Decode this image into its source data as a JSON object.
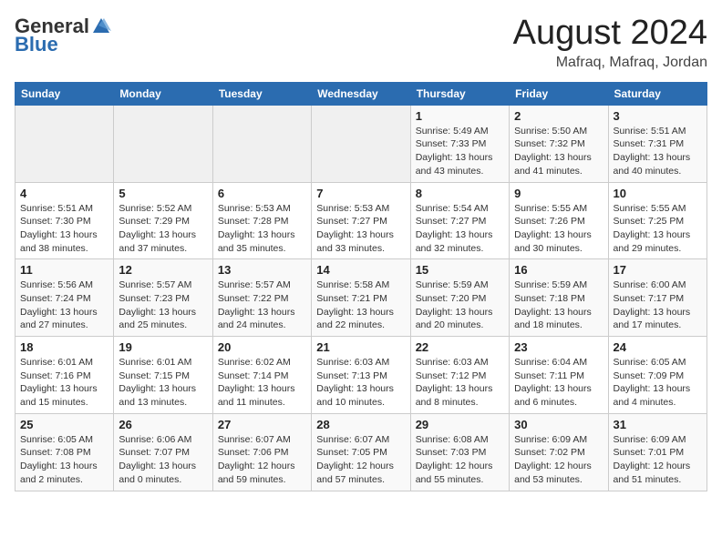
{
  "header": {
    "logo_general": "General",
    "logo_blue": "Blue",
    "main_title": "August 2024",
    "subtitle": "Mafraq, Mafraq, Jordan"
  },
  "days_of_week": [
    "Sunday",
    "Monday",
    "Tuesday",
    "Wednesday",
    "Thursday",
    "Friday",
    "Saturday"
  ],
  "weeks": [
    [
      {
        "day": "",
        "info": ""
      },
      {
        "day": "",
        "info": ""
      },
      {
        "day": "",
        "info": ""
      },
      {
        "day": "",
        "info": ""
      },
      {
        "day": "1",
        "info": "Sunrise: 5:49 AM\nSunset: 7:33 PM\nDaylight: 13 hours\nand 43 minutes."
      },
      {
        "day": "2",
        "info": "Sunrise: 5:50 AM\nSunset: 7:32 PM\nDaylight: 13 hours\nand 41 minutes."
      },
      {
        "day": "3",
        "info": "Sunrise: 5:51 AM\nSunset: 7:31 PM\nDaylight: 13 hours\nand 40 minutes."
      }
    ],
    [
      {
        "day": "4",
        "info": "Sunrise: 5:51 AM\nSunset: 7:30 PM\nDaylight: 13 hours\nand 38 minutes."
      },
      {
        "day": "5",
        "info": "Sunrise: 5:52 AM\nSunset: 7:29 PM\nDaylight: 13 hours\nand 37 minutes."
      },
      {
        "day": "6",
        "info": "Sunrise: 5:53 AM\nSunset: 7:28 PM\nDaylight: 13 hours\nand 35 minutes."
      },
      {
        "day": "7",
        "info": "Sunrise: 5:53 AM\nSunset: 7:27 PM\nDaylight: 13 hours\nand 33 minutes."
      },
      {
        "day": "8",
        "info": "Sunrise: 5:54 AM\nSunset: 7:27 PM\nDaylight: 13 hours\nand 32 minutes."
      },
      {
        "day": "9",
        "info": "Sunrise: 5:55 AM\nSunset: 7:26 PM\nDaylight: 13 hours\nand 30 minutes."
      },
      {
        "day": "10",
        "info": "Sunrise: 5:55 AM\nSunset: 7:25 PM\nDaylight: 13 hours\nand 29 minutes."
      }
    ],
    [
      {
        "day": "11",
        "info": "Sunrise: 5:56 AM\nSunset: 7:24 PM\nDaylight: 13 hours\nand 27 minutes."
      },
      {
        "day": "12",
        "info": "Sunrise: 5:57 AM\nSunset: 7:23 PM\nDaylight: 13 hours\nand 25 minutes."
      },
      {
        "day": "13",
        "info": "Sunrise: 5:57 AM\nSunset: 7:22 PM\nDaylight: 13 hours\nand 24 minutes."
      },
      {
        "day": "14",
        "info": "Sunrise: 5:58 AM\nSunset: 7:21 PM\nDaylight: 13 hours\nand 22 minutes."
      },
      {
        "day": "15",
        "info": "Sunrise: 5:59 AM\nSunset: 7:20 PM\nDaylight: 13 hours\nand 20 minutes."
      },
      {
        "day": "16",
        "info": "Sunrise: 5:59 AM\nSunset: 7:18 PM\nDaylight: 13 hours\nand 18 minutes."
      },
      {
        "day": "17",
        "info": "Sunrise: 6:00 AM\nSunset: 7:17 PM\nDaylight: 13 hours\nand 17 minutes."
      }
    ],
    [
      {
        "day": "18",
        "info": "Sunrise: 6:01 AM\nSunset: 7:16 PM\nDaylight: 13 hours\nand 15 minutes."
      },
      {
        "day": "19",
        "info": "Sunrise: 6:01 AM\nSunset: 7:15 PM\nDaylight: 13 hours\nand 13 minutes."
      },
      {
        "day": "20",
        "info": "Sunrise: 6:02 AM\nSunset: 7:14 PM\nDaylight: 13 hours\nand 11 minutes."
      },
      {
        "day": "21",
        "info": "Sunrise: 6:03 AM\nSunset: 7:13 PM\nDaylight: 13 hours\nand 10 minutes."
      },
      {
        "day": "22",
        "info": "Sunrise: 6:03 AM\nSunset: 7:12 PM\nDaylight: 13 hours\nand 8 minutes."
      },
      {
        "day": "23",
        "info": "Sunrise: 6:04 AM\nSunset: 7:11 PM\nDaylight: 13 hours\nand 6 minutes."
      },
      {
        "day": "24",
        "info": "Sunrise: 6:05 AM\nSunset: 7:09 PM\nDaylight: 13 hours\nand 4 minutes."
      }
    ],
    [
      {
        "day": "25",
        "info": "Sunrise: 6:05 AM\nSunset: 7:08 PM\nDaylight: 13 hours\nand 2 minutes."
      },
      {
        "day": "26",
        "info": "Sunrise: 6:06 AM\nSunset: 7:07 PM\nDaylight: 13 hours\nand 0 minutes."
      },
      {
        "day": "27",
        "info": "Sunrise: 6:07 AM\nSunset: 7:06 PM\nDaylight: 12 hours\nand 59 minutes."
      },
      {
        "day": "28",
        "info": "Sunrise: 6:07 AM\nSunset: 7:05 PM\nDaylight: 12 hours\nand 57 minutes."
      },
      {
        "day": "29",
        "info": "Sunrise: 6:08 AM\nSunset: 7:03 PM\nDaylight: 12 hours\nand 55 minutes."
      },
      {
        "day": "30",
        "info": "Sunrise: 6:09 AM\nSunset: 7:02 PM\nDaylight: 12 hours\nand 53 minutes."
      },
      {
        "day": "31",
        "info": "Sunrise: 6:09 AM\nSunset: 7:01 PM\nDaylight: 12 hours\nand 51 minutes."
      }
    ]
  ]
}
